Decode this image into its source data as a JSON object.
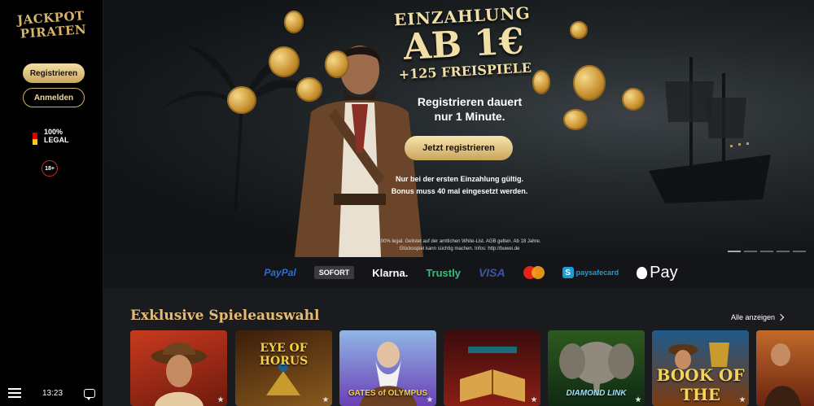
{
  "sidebar": {
    "logo_line1": "JACKPOT",
    "logo_line2": "PIRATEN",
    "register_label": "Registrieren",
    "login_label": "Anmelden",
    "legal_line1": "100%",
    "legal_line2": "LEGAL",
    "age_badge": "18+",
    "time": "13:23"
  },
  "hero": {
    "headline_line1": "EINZAHLUNG",
    "headline_line2": "AB 1€",
    "headline_line3": "+125 FREISPIELE",
    "subtitle_line1": "Registrieren dauert",
    "subtitle_line2": "nur 1 Minute.",
    "cta_label": "Jetzt registrieren",
    "note_line1": "Nur bei der ersten Einzahlung gültig.",
    "note_line2": "Bonus muss 40 mal eingesetzt werden.",
    "fine_print_line1": "100% legal. Gelistet auf der amtlichen White-List. AGB gelten. Ab 18 Jahre.",
    "fine_print_line2": "Glücksspiel kann süchtig machen. Infos: http://buwei.de"
  },
  "payments": {
    "paypal": "PayPal",
    "sofort": "SOFORT",
    "klarna": "Klarna.",
    "trustly": "Trustly",
    "visa": "VISA",
    "paysafe": "paysafecard",
    "applepay": "Pay"
  },
  "games": {
    "section_title": "Exklusive Spieleauswahl",
    "show_all": "Alle anzeigen",
    "items": [
      {
        "label": ""
      },
      {
        "label": "EYE OF HORUS"
      },
      {
        "label": "GATES of OLYMPUS"
      },
      {
        "label": ""
      },
      {
        "label": "DIAMOND LINK"
      },
      {
        "label": "BOOK OF THE"
      },
      {
        "label": ""
      }
    ]
  },
  "colors": {
    "gold": "#e3bb76",
    "sidebar_bg": "#000000",
    "page_bg": "#1a1b1f"
  }
}
